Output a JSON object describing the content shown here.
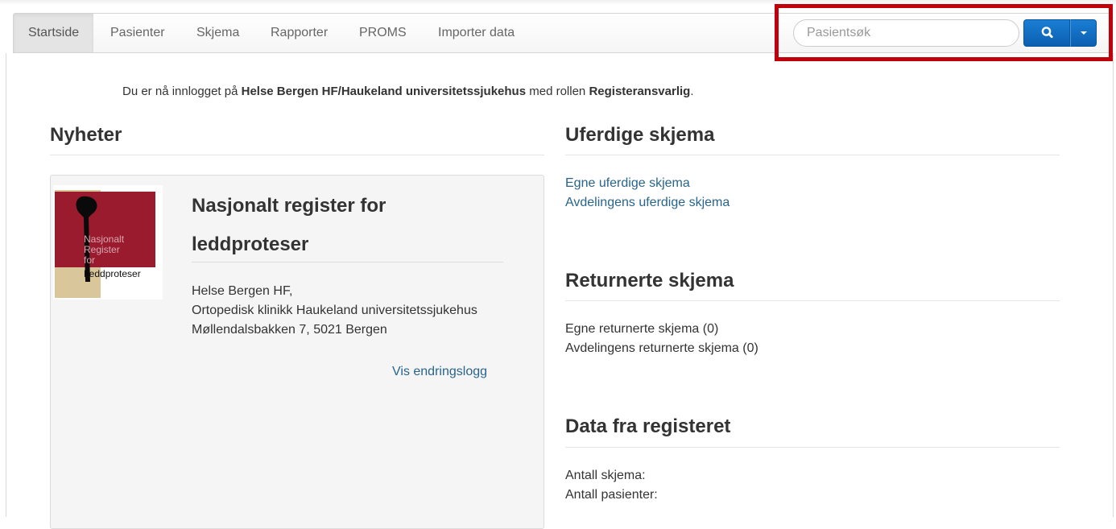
{
  "nav": {
    "items": [
      {
        "label": "Startside",
        "active": true
      },
      {
        "label": "Pasienter",
        "active": false
      },
      {
        "label": "Skjema",
        "active": false
      },
      {
        "label": "Rapporter",
        "active": false
      },
      {
        "label": "PROMS",
        "active": false
      },
      {
        "label": "Importer data",
        "active": false
      }
    ],
    "search": {
      "placeholder": "Pasientsøk",
      "button_icon": "search-icon",
      "dropdown_icon": "caret-down-icon"
    },
    "highlight_color": "#c0000b",
    "accent_color": "#0b6cc4"
  },
  "login": {
    "prefix": "Du er nå innlogget på ",
    "organization": "Helse Bergen HF/Haukeland universitetssjukehus",
    "middle": " med rollen ",
    "role": "Registeransvarlig",
    "suffix": "."
  },
  "news": {
    "heading": "Nyheter",
    "card": {
      "logo_text": [
        "Nasjonalt",
        "Register",
        "for",
        "Leddproteser"
      ],
      "title": "Nasjonalt register for leddproteser",
      "address_lines": [
        "Helse Bergen HF,",
        "Ortopedisk klinikk Haukeland universitetssjukehus",
        "Møllendalsbakken 7, 5021 Bergen"
      ],
      "changelog_link": "Vis endringslogg"
    }
  },
  "unfinished": {
    "heading": "Uferdige skjema",
    "links": [
      "Egne uferdige skjema",
      "Avdelingens uferdige skjema"
    ]
  },
  "returned": {
    "heading": "Returnerte skjema",
    "items": [
      "Egne returnerte skjema (0)",
      "Avdelingens returnerte skjema (0)"
    ]
  },
  "registry": {
    "heading": "Data fra registeret",
    "items": [
      "Antall skjema:",
      "Antall pasienter:"
    ]
  }
}
